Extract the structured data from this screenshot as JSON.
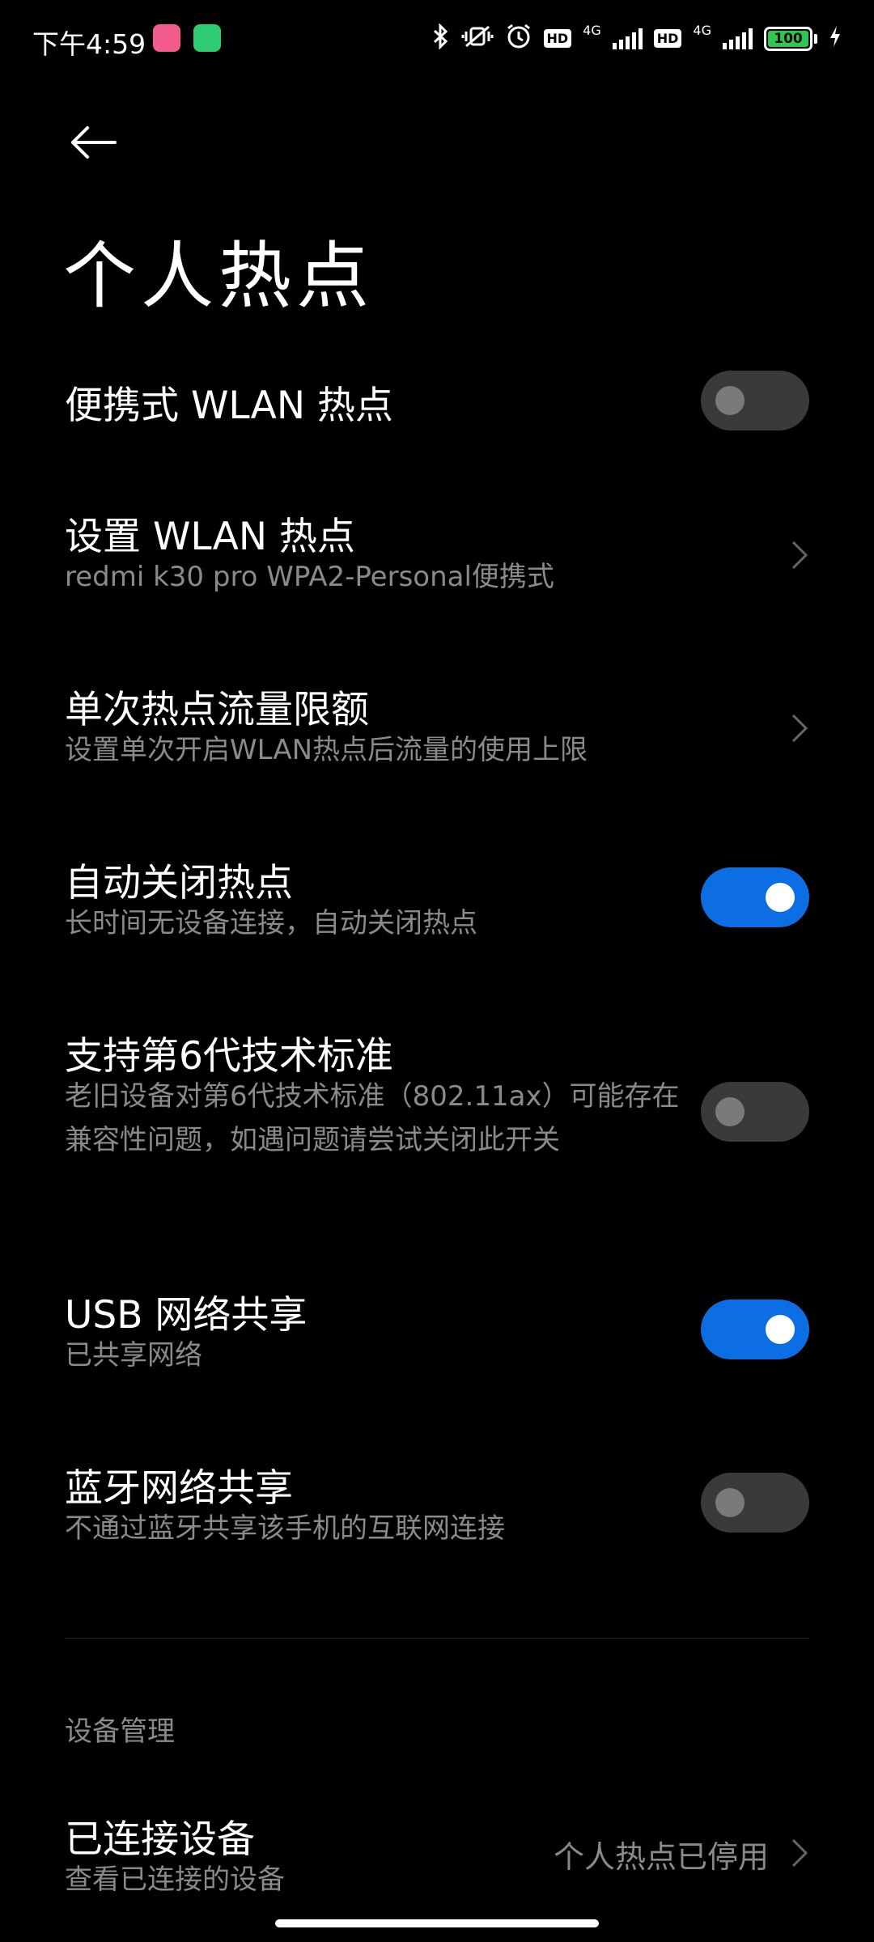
{
  "status_bar": {
    "time": "下午4:59",
    "network_label_1": "4G",
    "network_label_2": "4G",
    "hd_label": "HD",
    "battery_percent": "100",
    "icons": [
      "bilibili-app-icon",
      "green-app-icon",
      "bluetooth-icon",
      "mute-vibrate-icon",
      "alarm-icon",
      "signal-icon",
      "battery-icon",
      "charging-icon"
    ]
  },
  "header": {
    "title": "个人热点"
  },
  "settings": [
    {
      "title": "便携式 WLAN 热点",
      "subtitle": "",
      "control": "toggle",
      "on": false
    },
    {
      "title": "设置 WLAN 热点",
      "subtitle": "redmi k30 pro WPA2-Personal便携式",
      "control": "chevron"
    },
    {
      "title": "单次热点流量限额",
      "subtitle": "设置单次开启WLAN热点后流量的使用上限",
      "control": "chevron"
    },
    {
      "title": "自动关闭热点",
      "subtitle": "长时间无设备连接，自动关闭热点",
      "control": "toggle",
      "on": true
    },
    {
      "title": "支持第6代技术标准",
      "subtitle": "老旧设备对第6代技术标准（802.11ax）可能存在兼容性问题，如遇问题请尝试关闭此开关",
      "control": "toggle",
      "on": false
    },
    {
      "title": "USB 网络共享",
      "subtitle": "已共享网络",
      "control": "toggle",
      "on": true
    },
    {
      "title": "蓝牙网络共享",
      "subtitle": "不通过蓝牙共享该手机的互联网连接",
      "control": "toggle",
      "on": false
    }
  ],
  "device_section": {
    "header": "设备管理",
    "item": {
      "title": "已连接设备",
      "subtitle": "查看已连接的设备",
      "value": "个人热点已停用"
    }
  },
  "colors": {
    "background": "#000000",
    "toggle_on": "#0d6ee3",
    "toggle_off": "#3a3a3a",
    "secondary_text": "#8a8a8a"
  }
}
